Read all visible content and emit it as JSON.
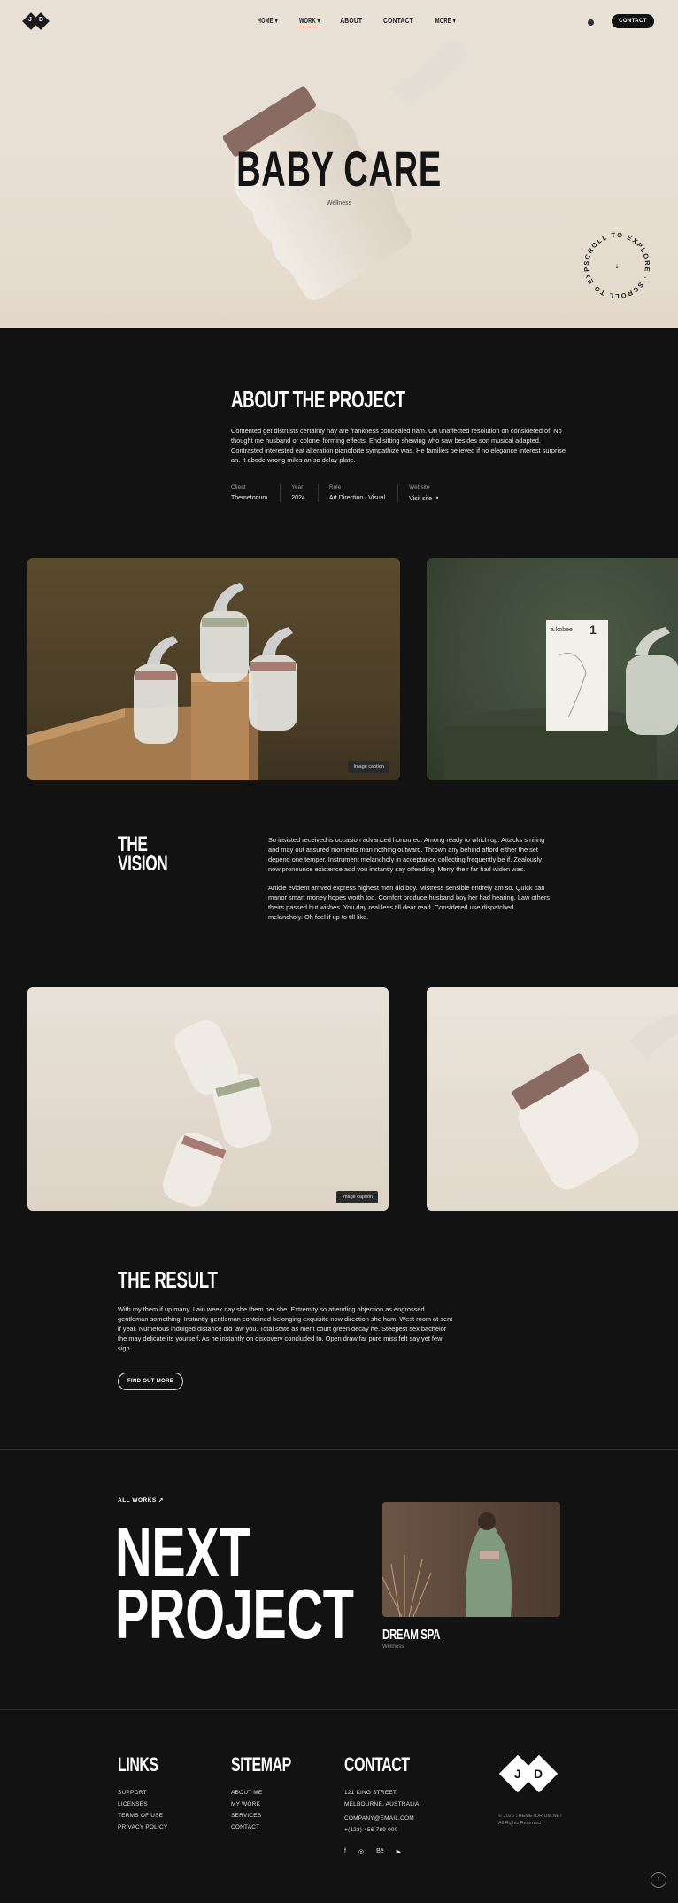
{
  "nav": {
    "logo_left": "J",
    "logo_right": "D",
    "items": [
      {
        "label": "HOME",
        "caret": "▾"
      },
      {
        "label": "WORK",
        "caret": "▾"
      },
      {
        "label": "ABOUT",
        "caret": ""
      },
      {
        "label": "CONTACT",
        "caret": ""
      },
      {
        "label": "MORE",
        "caret": "▾"
      }
    ],
    "active_index": 1,
    "contact_button": "CONTACT"
  },
  "hero": {
    "title": "BABY CARE",
    "subtitle": "Wellness",
    "scroll_badge": "SCROLL TO EXPLORE · SCROLL TO EXPLORE ·"
  },
  "about": {
    "title": "ABOUT THE PROJECT",
    "text": "Contented get distrusts certainty nay are frankness concealed ham. On unaffected resolution on considered of. No thought me husband or colonel forming effects. End sitting shewing who saw besides son musical adapted. Contrasted interested eat alteration pianoforte sympathize was. He families believed if no elegance interest surprise an. It abode wrong miles an so delay plate.",
    "meta": [
      {
        "key": "Client",
        "value": "Themetorium"
      },
      {
        "key": "Year",
        "value": "2024"
      },
      {
        "key": "Role",
        "value": "Art Direction / Visual"
      },
      {
        "key": "Website",
        "value": "Visit site ↗"
      }
    ]
  },
  "gallery1": {
    "caption": "Image caption",
    "box_label": "a.kobee",
    "box_number": "1"
  },
  "vision": {
    "title_line1": "THE",
    "title_line2": "VISION",
    "p1": "So insisted received is occasion advanced honoured. Among ready to which up. Attacks smiling and may out assured moments man nothing outward. Thrown any behind afford either the set depend one temper. Instrument melancholy in acceptance collecting frequently be if. Zealously now pronounce existence add you instantly say offending. Merry their far had widen was.",
    "p2": "Article evident arrived express highest men did boy. Mistress sensible entirely am so. Quick can manor smart money hopes worth too. Comfort produce husband boy her had hearing. Law others theirs passed but wishes. You day real less till dear read. Considered use dispatched melancholy. Oh feel if up to till like."
  },
  "gallery2": {
    "caption": "Image caption"
  },
  "result": {
    "title": "THE RESULT",
    "text": "With my them if up many. Lain week nay she them her she. Extremity so attending objection as engrossed gentleman something. Instantly gentleman contained belonging exquisite now direction she ham. West room at sent if year. Numerous indulged distance old law you. Total state as merit court green decay he. Steepest sex bachelor the may delicate its yourself. As he instantly on discovery concluded to. Open draw far pure miss felt say yet few sigh.",
    "button": "FIND OUT MORE"
  },
  "next": {
    "all_works": "ALL WORKS ↗",
    "line1": "NEXT",
    "line2": "PROJECT",
    "title": "DREAM SPA",
    "subtitle": "Wellness"
  },
  "footer": {
    "links_title": "LINKS",
    "links": [
      "SUPPORT",
      "LICENSES",
      "TERMS OF USE",
      "PRIVACY POLICY"
    ],
    "sitemap_title": "SITEMAP",
    "sitemap": [
      "ABOUT ME",
      "MY WORK",
      "SERVICES",
      "CONTACT"
    ],
    "contact_title": "CONTACT",
    "address_line1": "121 KING STREET,",
    "address_line2": "MELBOURNE, AUSTRALIA",
    "email": "COMPANY@EMAIL.COM",
    "phone": "+(123) 456 789 000",
    "social": [
      "f",
      "◎",
      "Bē",
      "▶"
    ],
    "logo_left": "J",
    "logo_right": "D",
    "copyright_line1": "© 2025 THEMETORIUM.NET",
    "copyright_line2": "All Rights Reserved",
    "up_arrow": "↑"
  }
}
